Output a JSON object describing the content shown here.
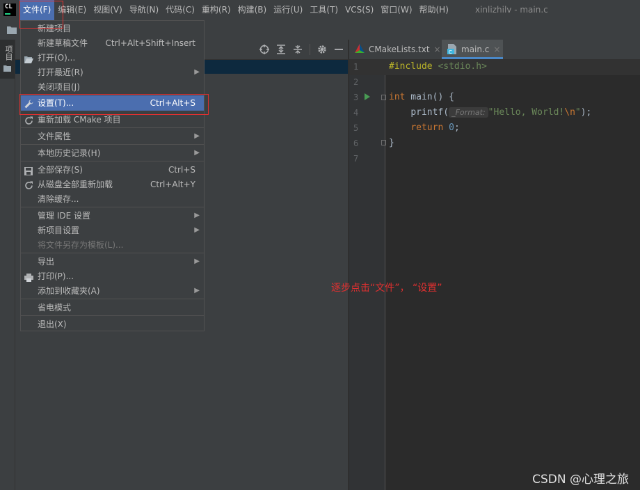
{
  "app_logo": "CL",
  "menubar": {
    "items": [
      "文件(F)",
      "编辑(E)",
      "视图(V)",
      "导航(N)",
      "代码(C)",
      "重构(R)",
      "构建(B)",
      "运行(U)",
      "工具(T)",
      "VCS(S)",
      "窗口(W)",
      "帮助(H)"
    ],
    "active_index": 0,
    "window_title": "xinlizhilv - main.c"
  },
  "left_strip": {
    "tab_label": "项目"
  },
  "editor": {
    "tabs": [
      {
        "label": "CMakeLists.txt",
        "icon": "cmake-icon",
        "active": false
      },
      {
        "label": "main.c",
        "icon": "c-file-icon",
        "active": true
      }
    ],
    "line_numbers": [
      "1",
      "2",
      "3",
      "4",
      "5",
      "6",
      "7"
    ],
    "code": {
      "include_kw": "#include",
      "include_target": "<stdio.h>",
      "int_kw": "int",
      "main_sig": " main() {",
      "printf_fn": "printf(",
      "param_hint": "_Format:",
      "string_text": "\"Hello, World!",
      "string_escape": "\\n",
      "string_end": "\"",
      "printf_end": ");",
      "return_kw": "return",
      "return_value": "0",
      "return_end": ";",
      "closing_brace": "}"
    }
  },
  "file_menu": {
    "items": [
      {
        "label": "新建项目",
        "shortcut": "",
        "submenu": false,
        "icon": ""
      },
      {
        "label": "新建草稿文件",
        "shortcut": "Ctrl+Alt+Shift+Insert",
        "submenu": false,
        "icon": ""
      },
      {
        "label": "打开(O)...",
        "shortcut": "",
        "submenu": false,
        "icon": "folder-open-icon"
      },
      {
        "label": "打开最近(R)",
        "shortcut": "",
        "submenu": true,
        "icon": ""
      },
      {
        "label": "关闭项目(J)",
        "shortcut": "",
        "submenu": false,
        "icon": ""
      },
      {
        "label": "设置(T)...",
        "shortcut": "Ctrl+Alt+S",
        "submenu": false,
        "icon": "wrench-icon",
        "selected": true
      },
      {
        "label": "重新加载 CMake 项目",
        "shortcut": "",
        "submenu": false,
        "icon": "reload-icon"
      },
      {
        "label": "文件属性",
        "shortcut": "",
        "submenu": true,
        "icon": ""
      },
      {
        "label": "本地历史记录(H)",
        "shortcut": "",
        "submenu": true,
        "icon": ""
      },
      {
        "label": "全部保存(S)",
        "shortcut": "Ctrl+S",
        "submenu": false,
        "icon": "save-icon"
      },
      {
        "label": "从磁盘全部重新加载",
        "shortcut": "Ctrl+Alt+Y",
        "submenu": false,
        "icon": "reload-icon"
      },
      {
        "label": "清除缓存...",
        "shortcut": "",
        "submenu": false,
        "icon": ""
      },
      {
        "label": "管理 IDE 设置",
        "shortcut": "",
        "submenu": true,
        "icon": ""
      },
      {
        "label": "新项目设置",
        "shortcut": "",
        "submenu": true,
        "icon": ""
      },
      {
        "label": "将文件另存为模板(L)...",
        "shortcut": "",
        "submenu": false,
        "icon": "",
        "disabled": true
      },
      {
        "label": "导出",
        "shortcut": "",
        "submenu": true,
        "icon": ""
      },
      {
        "label": "打印(P)...",
        "shortcut": "",
        "submenu": false,
        "icon": "print-icon"
      },
      {
        "label": "添加到收藏夹(A)",
        "shortcut": "",
        "submenu": true,
        "icon": ""
      },
      {
        "label": "省电模式",
        "shortcut": "",
        "submenu": false,
        "icon": ""
      },
      {
        "label": "退出(X)",
        "shortcut": "",
        "submenu": false,
        "icon": ""
      }
    ]
  },
  "annotation": "逐步点击“文件”， “设置”",
  "watermark": "CSDN @心理之旅",
  "colors": {
    "accent": "#4b6eaf",
    "annotation_red": "#e03030",
    "background": "#2b2b2b",
    "panel": "#3c3f41"
  }
}
